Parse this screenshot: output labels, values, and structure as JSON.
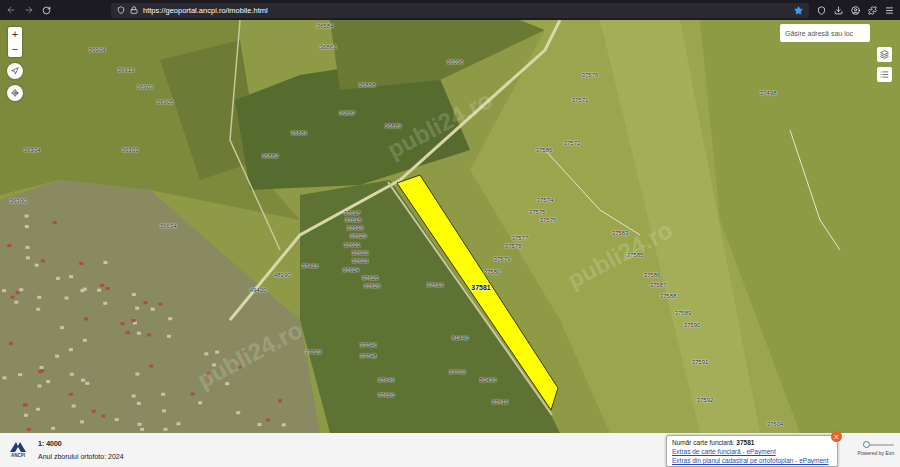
{
  "browser": {
    "url": "https://geoportal.ancpi.ro/imobile.html",
    "bookmarked": true
  },
  "map": {
    "search_placeholder": "Găsire adresă sau loc",
    "zoom_in": "+",
    "zoom_out": "−",
    "watermark": "publi24.ro",
    "parcels": [
      {
        "number": "36584",
        "selected": false
      },
      {
        "number": "36863",
        "selected": false
      },
      {
        "number": "36096",
        "selected": false
      },
      {
        "number": "36888",
        "selected": false
      },
      {
        "number": "36887",
        "selected": false
      },
      {
        "number": "36889",
        "selected": false
      },
      {
        "number": "36881",
        "selected": false
      },
      {
        "number": "36882",
        "selected": false
      },
      {
        "number": "36904",
        "selected": false
      },
      {
        "number": "36913",
        "selected": false
      },
      {
        "number": "36907",
        "selected": false
      },
      {
        "number": "36905",
        "selected": false
      },
      {
        "number": "36303",
        "selected": false
      },
      {
        "number": "36304",
        "selected": false
      },
      {
        "number": "36300",
        "selected": false
      },
      {
        "number": "36634",
        "selected": false
      },
      {
        "number": "37576",
        "selected": false
      },
      {
        "number": "37571",
        "selected": false
      },
      {
        "number": "37498",
        "selected": false
      },
      {
        "number": "37572",
        "selected": false
      },
      {
        "number": "37586",
        "selected": false
      },
      {
        "number": "37574",
        "selected": false
      },
      {
        "number": "37575",
        "selected": false
      },
      {
        "number": "37576",
        "selected": false
      },
      {
        "number": "37577",
        "selected": false
      },
      {
        "number": "37578",
        "selected": false
      },
      {
        "number": "37579",
        "selected": false
      },
      {
        "number": "37580",
        "selected": false
      },
      {
        "number": "37581",
        "selected": true
      },
      {
        "number": "37583",
        "selected": false
      },
      {
        "number": "37585",
        "selected": false
      },
      {
        "number": "37586",
        "selected": false
      },
      {
        "number": "37587",
        "selected": false
      },
      {
        "number": "37588",
        "selected": false
      },
      {
        "number": "37589",
        "selected": false
      },
      {
        "number": "37590",
        "selected": false
      },
      {
        "number": "37591",
        "selected": false
      },
      {
        "number": "37592",
        "selected": false
      },
      {
        "number": "37604",
        "selected": false
      },
      {
        "number": "37613",
        "selected": false
      },
      {
        "number": "37617",
        "selected": false
      },
      {
        "number": "37618",
        "selected": false
      },
      {
        "number": "37619",
        "selected": false
      },
      {
        "number": "37620",
        "selected": false
      },
      {
        "number": "37621",
        "selected": false
      },
      {
        "number": "37622",
        "selected": false
      },
      {
        "number": "37623",
        "selected": false
      },
      {
        "number": "37624",
        "selected": false
      },
      {
        "number": "37625",
        "selected": false
      },
      {
        "number": "37626",
        "selected": false
      },
      {
        "number": "37416",
        "selected": false
      },
      {
        "number": "48990",
        "selected": false
      },
      {
        "number": "49420",
        "selected": false
      },
      {
        "number": "37723",
        "selected": false
      },
      {
        "number": "37730",
        "selected": false
      },
      {
        "number": "51440",
        "selected": false
      },
      {
        "number": "51430",
        "selected": false
      },
      {
        "number": "37612",
        "selected": false
      },
      {
        "number": "37746",
        "selected": false
      },
      {
        "number": "37748",
        "selected": false
      },
      {
        "number": "37649",
        "selected": false
      },
      {
        "number": "37650",
        "selected": false
      }
    ]
  },
  "status_bar": {
    "logo": "ANCPI",
    "scale": "1: 4000",
    "ortho_year": "Anul zborului ortofoto: 2024",
    "attribution": "Powered by Esri",
    "opacity_slider": {
      "level": 0.1
    }
  },
  "popup": {
    "label": "Număr carte funciară: ",
    "value": "37581",
    "close": "×",
    "links": [
      "Extras de carte funciară - ePayment",
      "Extras din planul cadastral pe ortofotoplan - ePayment"
    ]
  }
}
